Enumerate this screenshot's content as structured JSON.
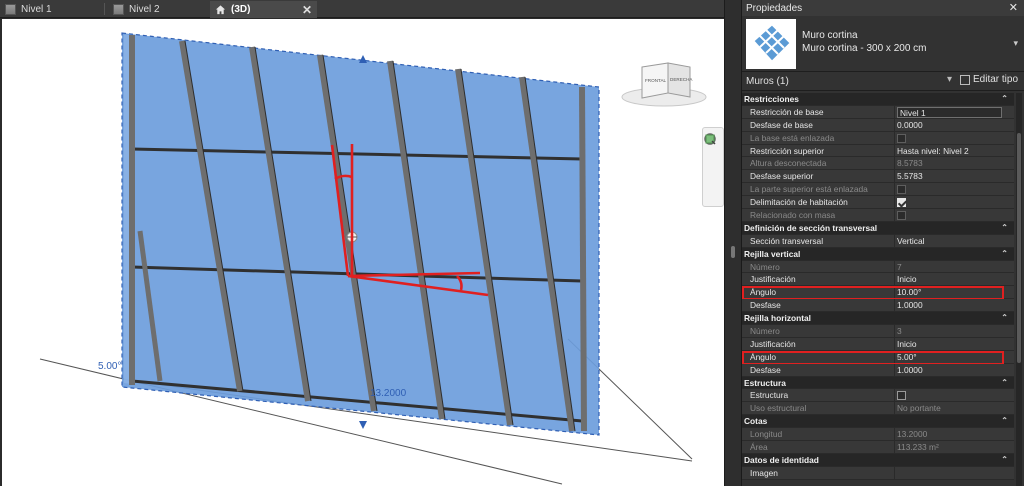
{
  "tabs": [
    {
      "label": "Nivel 1",
      "active": false
    },
    {
      "label": "Nivel 2",
      "active": false
    },
    {
      "label": "(3D)",
      "active": true
    }
  ],
  "tab_close": "✕",
  "viewport": {
    "dim_angle": "5.00°",
    "dim_length": "13.2000",
    "viewcube_front": "FRONTAL",
    "viewcube_right": "DERECHA"
  },
  "properties": {
    "title": "Propiedades",
    "close": "✕",
    "type_family": "Muro cortina",
    "type_name": "Muro cortina - 300 x 200 cm",
    "category_label": "Muros (1)",
    "edit_type": "Editar tipo",
    "sections": [
      {
        "name": "Restricciones",
        "params": [
          {
            "label": "Restricción de base",
            "value": "Nivel 1",
            "box": true
          },
          {
            "label": "Desfase de base",
            "value": "0.0000"
          },
          {
            "label": "La base está enlazada",
            "check": false,
            "dim": true
          },
          {
            "label": "Restricción superior",
            "value": "Hasta nivel: Nivel 2"
          },
          {
            "label": "Altura desconectada",
            "value": "8.5783",
            "dim": true
          },
          {
            "label": "Desfase superior",
            "value": "5.5783"
          },
          {
            "label": "La parte superior está enlazada",
            "check": false,
            "dim": true
          },
          {
            "label": "Delimitación de habitación",
            "check": true
          },
          {
            "label": "Relacionado con masa",
            "check": false,
            "dim": true
          }
        ]
      },
      {
        "name": "Definición de sección transversal",
        "params": [
          {
            "label": "Sección transversal",
            "value": "Vertical"
          }
        ]
      },
      {
        "name": "Rejilla vertical",
        "params": [
          {
            "label": "Número",
            "value": "7",
            "dim": true
          },
          {
            "label": "Justificación",
            "value": "Inicio"
          },
          {
            "label": "Ángulo",
            "value": "10.00°",
            "highlight": true
          },
          {
            "label": "Desfase",
            "value": "1.0000"
          }
        ]
      },
      {
        "name": "Rejilla horizontal",
        "params": [
          {
            "label": "Número",
            "value": "3",
            "dim": true
          },
          {
            "label": "Justificación",
            "value": "Inicio"
          },
          {
            "label": "Ángulo",
            "value": "5.00°",
            "highlight": true
          },
          {
            "label": "Desfase",
            "value": "1.0000"
          }
        ]
      },
      {
        "name": "Estructura",
        "params": [
          {
            "label": "Estructura",
            "check": false
          },
          {
            "label": "Uso estructural",
            "value": "No portante",
            "dim": true
          }
        ]
      },
      {
        "name": "Cotas",
        "params": [
          {
            "label": "Longitud",
            "value": "13.2000",
            "dim": true
          },
          {
            "label": "Área",
            "value": "113.233 m²",
            "dim": true
          }
        ]
      },
      {
        "name": "Datos de identidad",
        "params": [
          {
            "label": "Imagen",
            "value": ""
          }
        ]
      }
    ]
  },
  "colors": {
    "glass": "#6d9ddc",
    "glass_edge": "#2f5fb4",
    "mullion": "#6e6e6e",
    "markup": "#e02020"
  }
}
